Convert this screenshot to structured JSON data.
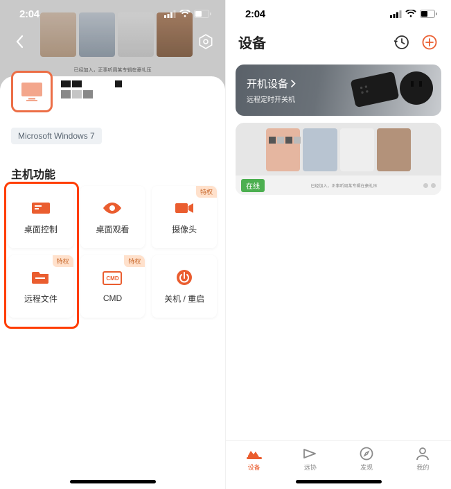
{
  "status": {
    "time": "2:04"
  },
  "left": {
    "os_badge": "Microsoft Windows 7",
    "section_title": "主机功能",
    "perk_label": "特权",
    "functions": [
      {
        "label": "桌面控制",
        "icon": "desktop-control-icon",
        "perk": false
      },
      {
        "label": "桌面观看",
        "icon": "eye-icon",
        "perk": false
      },
      {
        "label": "摄像头",
        "icon": "camera-icon",
        "perk": true
      },
      {
        "label": "远程文件",
        "icon": "folder-icon",
        "perk": true
      },
      {
        "label": "CMD",
        "icon": "cmd-icon",
        "perk": true
      },
      {
        "label": "关机 / 重启",
        "icon": "power-icon",
        "perk": false
      }
    ],
    "blog_caption": "已经加入，正事听周某专辑在豪礼压"
  },
  "right": {
    "title": "设备",
    "promo": {
      "line1": "开机设备",
      "line2": "远程定时开关机"
    },
    "online_label": "在线",
    "device_caption": "已经加入，正事听周某专辑在豪礼压",
    "tabs": [
      {
        "label": "设备",
        "icon": "devices-tab-icon",
        "active": true
      },
      {
        "label": "远协",
        "icon": "remote-tab-icon",
        "active": false
      },
      {
        "label": "发现",
        "icon": "discover-tab-icon",
        "active": false
      },
      {
        "label": "我的",
        "icon": "profile-tab-icon",
        "active": false
      }
    ]
  }
}
